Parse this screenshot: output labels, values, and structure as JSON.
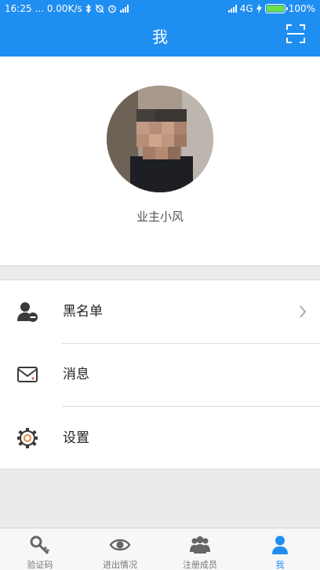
{
  "status_bar": {
    "time": "16:25",
    "net_speed": "... 0.00K/s",
    "network_type": "4G",
    "battery": "100%",
    "battery_level": 1.0
  },
  "header": {
    "title": "我",
    "scan_icon": "scan-icon"
  },
  "profile": {
    "name": "业主小风"
  },
  "menu": {
    "items": [
      {
        "label": "黑名单",
        "icon": "blacklist-user-icon",
        "chevron": true
      },
      {
        "label": "消息",
        "icon": "message-envelope-icon",
        "chevron": false
      },
      {
        "label": "设置",
        "icon": "settings-gear-icon",
        "chevron": false
      }
    ]
  },
  "bottom_nav": {
    "items": [
      {
        "label": "验证码",
        "icon": "key-icon"
      },
      {
        "label": "进出情况",
        "icon": "eye-icon"
      },
      {
        "label": "注册成员",
        "icon": "group-icon"
      },
      {
        "label": "我",
        "icon": "person-icon"
      }
    ],
    "active_index": 3
  },
  "colors": {
    "primary": "#1f8ef1",
    "background": "#ebebeb",
    "inactive_icon": "#666666"
  }
}
